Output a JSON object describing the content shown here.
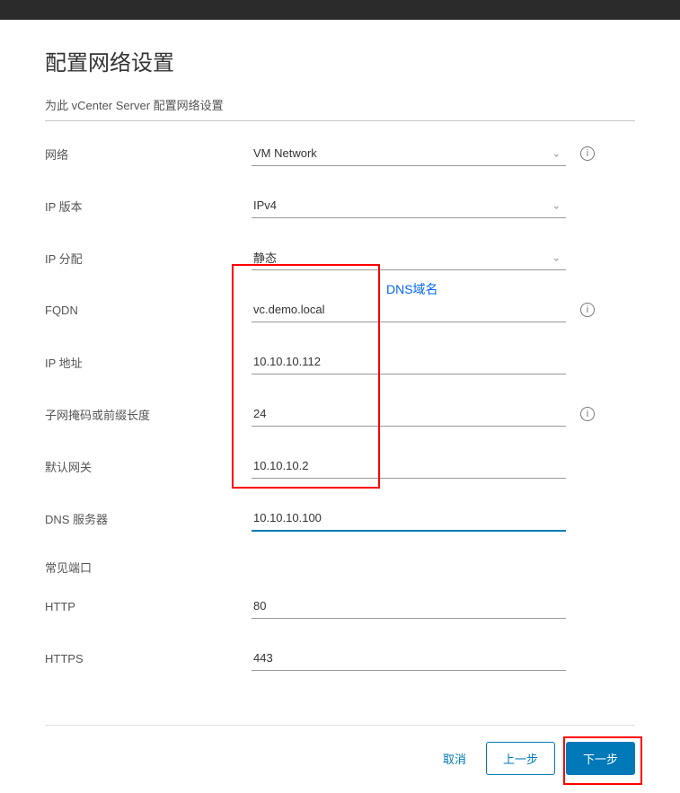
{
  "header": {
    "title": "配置网络设置",
    "subtitle": "为此 vCenter Server 配置网络设置"
  },
  "fields": {
    "network": {
      "label": "网络",
      "value": "VM Network"
    },
    "ip_version": {
      "label": "IP 版本",
      "value": "IPv4"
    },
    "ip_alloc": {
      "label": "IP 分配",
      "value": "静态"
    },
    "fqdn": {
      "label": "FQDN",
      "value": "vc.demo.local"
    },
    "ip_addr": {
      "label": "IP 地址",
      "value": "10.10.10.112"
    },
    "subnet": {
      "label": "子网掩码或前缀长度",
      "value": "24"
    },
    "gateway": {
      "label": "默认网关",
      "value": "10.10.10.2"
    },
    "dns": {
      "label": "DNS 服务器",
      "value": "10.10.10.100"
    },
    "common_ports": {
      "label": "常见端口"
    },
    "http": {
      "label": "HTTP",
      "value": "80"
    },
    "https": {
      "label": "HTTPS",
      "value": "443"
    }
  },
  "annotations": {
    "dns_domain_label": "DNS域名"
  },
  "footer": {
    "cancel": "取消",
    "prev": "上一步",
    "next": "下一步"
  },
  "icons": {
    "info": "i",
    "chevron": "⌄"
  }
}
